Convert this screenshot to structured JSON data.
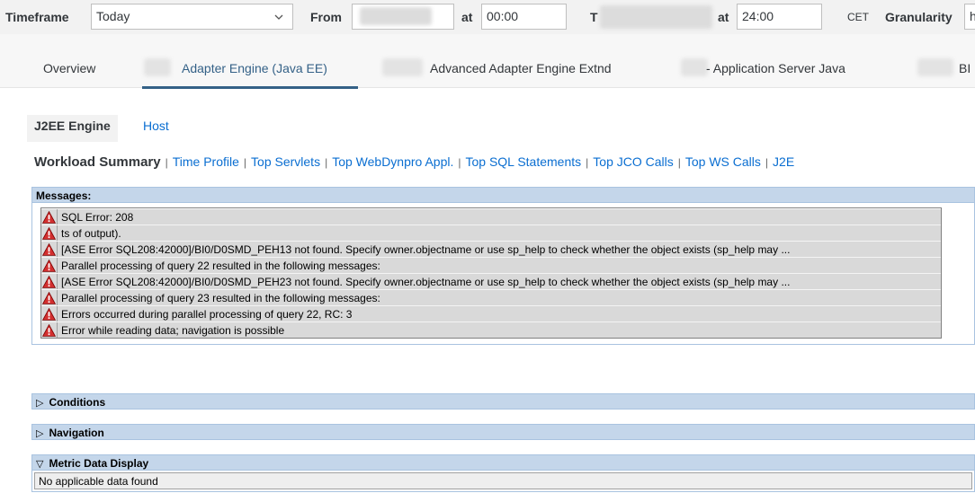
{
  "filter": {
    "timeframe_label": "Timeframe",
    "timeframe_value": "Today",
    "from_label": "From",
    "at_label": "at",
    "from_time": "00:00",
    "to_label_partial": "T",
    "at_label_partial": "at",
    "to_time": "24:00",
    "timezone": "CET",
    "granularity_label": "Granularity",
    "granularity_value": "h"
  },
  "tabs": [
    {
      "label": "Overview"
    },
    {
      "label": "Adapter Engine (Java EE)",
      "active": true
    },
    {
      "label": "Advanced Adapter Engine Extnd"
    },
    {
      "label": "- Application Server Java"
    },
    {
      "label": "BI"
    }
  ],
  "subtabs": [
    {
      "label": "J2EE Engine",
      "active": true
    },
    {
      "label": "Host"
    }
  ],
  "links": {
    "current": "Workload Summary",
    "items": [
      "Time Profile",
      "Top Servlets",
      "Top WebDynpro Appl.",
      "Top SQL Statements",
      "Top JCO Calls",
      "Top WS Calls",
      "J2E"
    ]
  },
  "messages": {
    "title": "Messages:",
    "rows": [
      "SQL Error: 208",
      "ts of output).",
      "[ASE Error SQL208:42000]/BI0/D0SMD_PEH13 not found. Specify owner.objectname or use sp_help to check whether the object exists (sp_help may ...",
      "Parallel processing of query 22 resulted in the following messages:",
      "[ASE Error SQL208:42000]/BI0/D0SMD_PEH23 not found. Specify owner.objectname or use sp_help to check whether the object exists (sp_help may ...",
      "Parallel processing of query 23 resulted in the following messages:",
      "Errors occurred during parallel processing of query 22, RC: 3",
      "Error while reading data; navigation is possible"
    ]
  },
  "sections": {
    "conditions": "Conditions",
    "navigation": "Navigation",
    "metric": "Metric Data Display",
    "no_data": "No applicable data found"
  },
  "colors": {
    "accent": "#346187",
    "link": "#0a6ed1",
    "panel_header": "#c4d6ea",
    "error_icon": "#d32f2f"
  }
}
